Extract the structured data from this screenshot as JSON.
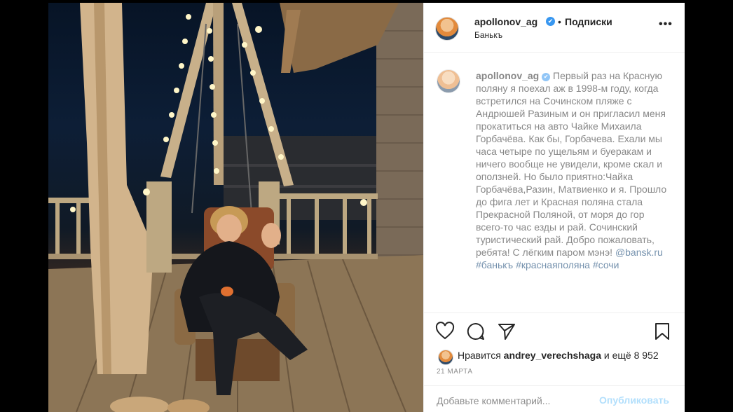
{
  "post": {
    "username": "apollonov_ag",
    "verified_mark": "✔",
    "separator": "•",
    "follow_label": "Подписки",
    "location": "Банькъ",
    "more_label": "•••"
  },
  "caption": {
    "username": "apollonov_ag",
    "text": "Первый раз на Красную поляну я поехал аж в 1998-м году, когда встретился на Сочинском пляже с Андрюшей Разиным и он пригласил меня прокатиться на авто Чайке Михаила Горбачёва. Как бы, Горбачева. Ехали мы часа четыре по ущельям и буеракам и ничего вообще не увидели, кроме скал и оползней. Но было приятно:Чайка Горбачёва,Разин, Матвиенко и я. Прошло до фига лет и Красная поляна стала Прекрасной Поляной, от моря до гор всего-то час езды и рай. Сочинский туристический рай. Добро пожаловать, ребята! С лёгким паром мэнэ!",
    "links": [
      "@bansk.ru",
      "#банькъ",
      "#краснаяполяна",
      "#сочи"
    ]
  },
  "likes": {
    "prefix": "Нравится",
    "user": "andrey_verechshaga",
    "suffix": "и ещё 8 952"
  },
  "date": "21 марта",
  "comment_input": {
    "placeholder": "Добавьте комментарий...",
    "publish_label": "Опубликовать"
  },
  "icons": {
    "like": "heart-icon",
    "comment": "comment-icon",
    "share": "share-icon",
    "save": "bookmark-icon",
    "more": "more-icon"
  },
  "colors": {
    "link": "#003569",
    "verified": "#3897f0",
    "publish_disabled": "#b2dffc",
    "secondary_text": "#8e8e8e"
  }
}
